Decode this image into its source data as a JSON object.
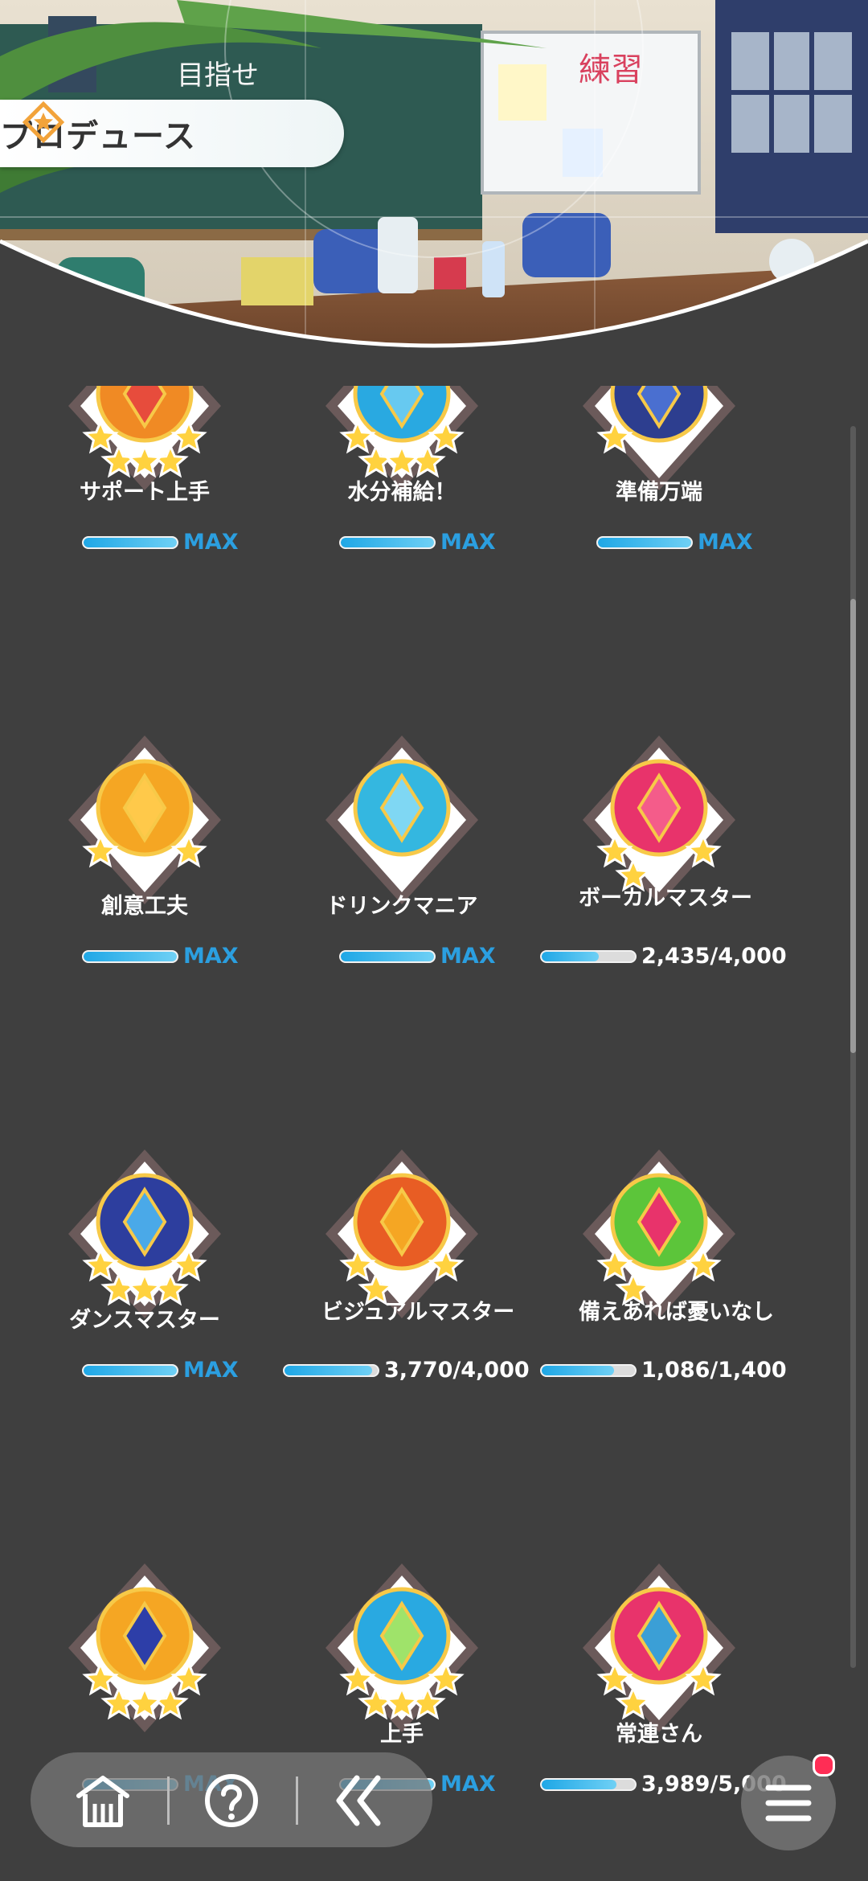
{
  "header": {
    "title": "プロデュース"
  },
  "achievements": [
    {
      "name": "サポート上手",
      "progress": "MAX",
      "fill": 1.0,
      "theme": "orange-red",
      "stars": 5
    },
    {
      "name": "水分補給！",
      "progress": "MAX",
      "fill": 1.0,
      "theme": "sky",
      "stars": 5
    },
    {
      "name": "準備万端",
      "progress": "MAX",
      "fill": 1.0,
      "theme": "navy",
      "stars": 1
    },
    {
      "name": "創意工夫",
      "progress": "MAX",
      "fill": 1.0,
      "theme": "bulb",
      "stars": 2
    },
    {
      "name": "ドリンクマニア",
      "progress": "MAX",
      "fill": 1.0,
      "theme": "drink",
      "stars": 0
    },
    {
      "name": "ボーカルマスター",
      "progress": "2,435/4,000",
      "fill": 0.61,
      "theme": "vocal",
      "stars": 3
    },
    {
      "name": "ダンスマスター",
      "progress": "MAX",
      "fill": 1.0,
      "theme": "dance",
      "stars": 5
    },
    {
      "name": "ビジュアルマスター",
      "progress": "3,770/4,000",
      "fill": 0.94,
      "theme": "visual",
      "stars": 3
    },
    {
      "name": "備えあれば憂いなし",
      "progress": "1,086/1,400",
      "fill": 0.78,
      "theme": "bag",
      "stars": 3
    },
    {
      "name": "",
      "progress": "MAX",
      "fill": 1.0,
      "theme": "star-hat",
      "stars": 5
    },
    {
      "name": "上手",
      "progress": "MAX",
      "fill": 1.0,
      "theme": "ball",
      "stars": 5
    },
    {
      "name": "常連さん",
      "progress": "3,989/5,000",
      "fill": 0.8,
      "theme": "rose",
      "stars": 3
    }
  ],
  "nav": {
    "home_icon": "home-icon",
    "help_icon": "help-icon",
    "back_icon": "double-chevron-left-icon",
    "menu_icon": "hamburger-menu-icon"
  },
  "colors": {
    "background": "#3f3f3f",
    "progress_fill": "#1fa7e6",
    "max_text": "#2b9fe0",
    "notification_dot": "#ff2d55"
  }
}
